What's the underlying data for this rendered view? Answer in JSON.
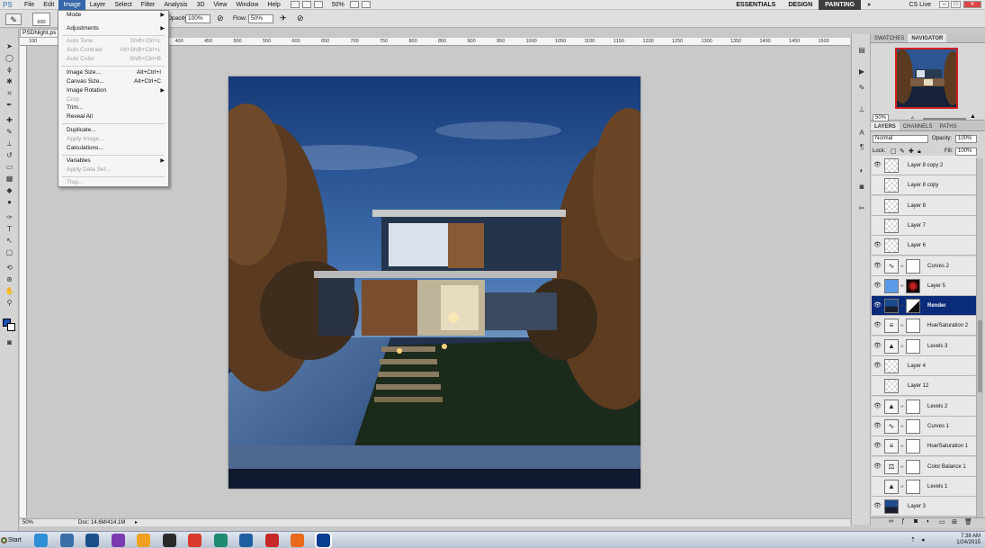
{
  "menubar": {
    "logo": "PS",
    "menus": [
      "File",
      "Edit",
      "Image",
      "Layer",
      "Select",
      "Filter",
      "Analysis",
      "3D",
      "View",
      "Window",
      "Help"
    ],
    "zoom": "50%",
    "workspaces": [
      "ESSENTIALS",
      "DESIGN",
      "PAINTING"
    ],
    "active_workspace": "PAINTING",
    "more": "»",
    "cslive": "CS Live"
  },
  "options": {
    "brush_size": "600",
    "opacity_label": "Opacity:",
    "opacity_value": "100%",
    "flow_label": "Flow:",
    "flow_value": "50%"
  },
  "document": {
    "tab": "PSDNight.ps",
    "ruler_marks": [
      "100",
      "200",
      "250",
      "300",
      "350",
      "400",
      "450",
      "500",
      "550",
      "600",
      "650",
      "700",
      "750",
      "800",
      "850",
      "900",
      "950",
      "1000",
      "1050",
      "1100",
      "1150",
      "1200",
      "1250",
      "1300",
      "1350",
      "1400",
      "1450",
      "1500"
    ],
    "status_zoom": "50%",
    "status_doc": "Doc: 14.6M/414.1M"
  },
  "image_menu": {
    "items": [
      {
        "label": "Mode",
        "shortcut": "",
        "submenu": true,
        "disabled": false
      },
      {
        "label": "Adjustments",
        "shortcut": "",
        "submenu": true,
        "disabled": false
      },
      {
        "label": "Auto Tone",
        "shortcut": "Shift+Ctrl+L",
        "submenu": false,
        "disabled": true
      },
      {
        "label": "Auto Contrast",
        "shortcut": "Alt+Shift+Ctrl+L",
        "submenu": false,
        "disabled": true
      },
      {
        "label": "Auto Color",
        "shortcut": "Shift+Ctrl+B",
        "submenu": false,
        "disabled": true
      },
      {
        "label": "Image Size...",
        "shortcut": "Alt+Ctrl+I",
        "submenu": false,
        "disabled": false
      },
      {
        "label": "Canvas Size...",
        "shortcut": "Alt+Ctrl+C",
        "submenu": false,
        "disabled": false
      },
      {
        "label": "Image Rotation",
        "shortcut": "",
        "submenu": true,
        "disabled": false
      },
      {
        "label": "Crop",
        "shortcut": "",
        "submenu": false,
        "disabled": true
      },
      {
        "label": "Trim...",
        "shortcut": "",
        "submenu": false,
        "disabled": false
      },
      {
        "label": "Reveal All",
        "shortcut": "",
        "submenu": false,
        "disabled": false
      },
      {
        "label": "Duplicate...",
        "shortcut": "",
        "submenu": false,
        "disabled": false
      },
      {
        "label": "Apply Image...",
        "shortcut": "",
        "submenu": false,
        "disabled": true
      },
      {
        "label": "Calculations...",
        "shortcut": "",
        "submenu": false,
        "disabled": false
      },
      {
        "label": "Variables",
        "shortcut": "",
        "submenu": true,
        "disabled": false
      },
      {
        "label": "Apply Data Set...",
        "shortcut": "",
        "submenu": false,
        "disabled": true
      },
      {
        "label": "Trap...",
        "shortcut": "",
        "submenu": false,
        "disabled": true
      }
    ]
  },
  "navigator": {
    "tabs": [
      "SWATCHES",
      "NAVIGATOR"
    ],
    "active_tab": "NAVIGATOR",
    "zoom": "50%"
  },
  "layers_panel": {
    "tabs": [
      "LAYERS",
      "CHANNELS",
      "PATHS"
    ],
    "active_tab": "LAYERS",
    "blend_mode": "Normal",
    "opacity_label": "Opacity:",
    "opacity_value": "100%",
    "lock_label": "Lock:",
    "fill_label": "Fill:",
    "fill_value": "100%",
    "layers": [
      {
        "name": "Layer 8 copy 2",
        "visible": true,
        "kind": "pixel",
        "mask": false,
        "selected": false
      },
      {
        "name": "Layer 8 copy",
        "visible": false,
        "kind": "pixel",
        "mask": false,
        "selected": false
      },
      {
        "name": "Layer 8",
        "visible": false,
        "kind": "pixel",
        "mask": false,
        "selected": false
      },
      {
        "name": "Layer 7",
        "visible": false,
        "kind": "pixel",
        "mask": false,
        "selected": false
      },
      {
        "name": "Layer 6",
        "visible": true,
        "kind": "pixel",
        "mask": false,
        "selected": false
      },
      {
        "name": "Curves 2",
        "visible": true,
        "kind": "curves",
        "mask": true,
        "selected": false
      },
      {
        "name": "Layer 5",
        "visible": true,
        "kind": "color",
        "mask": true,
        "selected": false
      },
      {
        "name": "Render",
        "visible": true,
        "kind": "render",
        "mask": true,
        "selected": true
      },
      {
        "name": "Hue/Saturation 2",
        "visible": true,
        "kind": "hue",
        "mask": true,
        "selected": false
      },
      {
        "name": "Levels 3",
        "visible": true,
        "kind": "levels",
        "mask": true,
        "selected": false
      },
      {
        "name": "Layer 4",
        "visible": true,
        "kind": "pixel",
        "mask": false,
        "selected": false
      },
      {
        "name": "Layer 12",
        "visible": false,
        "kind": "pixel",
        "mask": false,
        "selected": false
      },
      {
        "name": "Levels 2",
        "visible": true,
        "kind": "levels",
        "mask": true,
        "selected": false
      },
      {
        "name": "Curves 1",
        "visible": true,
        "kind": "curves",
        "mask": true,
        "selected": false
      },
      {
        "name": "Hue/Saturation 1",
        "visible": true,
        "kind": "hue",
        "mask": true,
        "selected": false
      },
      {
        "name": "Color Balance 1",
        "visible": true,
        "kind": "balance",
        "mask": true,
        "selected": false
      },
      {
        "name": "Levels 1",
        "visible": false,
        "kind": "levels",
        "mask": true,
        "selected": false
      },
      {
        "name": "Layer 3",
        "visible": true,
        "kind": "render",
        "mask": false,
        "selected": false
      }
    ]
  },
  "taskbar": {
    "start": "Start",
    "time": "7:38 AM",
    "date": "1/24/2015",
    "app_colors": [
      "#2d8fd5",
      "#3a6ea8",
      "#1b4f8a",
      "#7a3bb0",
      "#f0a020",
      "#2a2a2a",
      "#d83b2b",
      "#1f8a70",
      "#1c5fa0",
      "#c62828",
      "#e86a1a",
      "#0b3d91"
    ]
  },
  "colors": {
    "accent": "#3468a8",
    "foreground_swatch": "#1a4fb0",
    "selected_layer": "#0a2a7a"
  }
}
